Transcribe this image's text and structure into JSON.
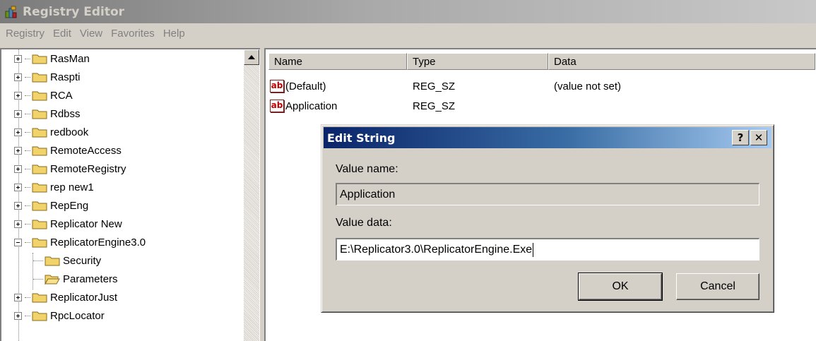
{
  "window": {
    "title": "Registry Editor",
    "icon": "registry-editor-icon"
  },
  "menu": [
    "Registry",
    "Edit",
    "View",
    "Favorites",
    "Help"
  ],
  "tree": {
    "items": [
      {
        "label": "RasMan",
        "expander": "plus",
        "icon": "folder-icon"
      },
      {
        "label": "Raspti",
        "expander": "plus",
        "icon": "folder-icon"
      },
      {
        "label": "RCA",
        "expander": "plus",
        "icon": "folder-icon"
      },
      {
        "label": "Rdbss",
        "expander": "plus",
        "icon": "folder-icon"
      },
      {
        "label": "redbook",
        "expander": "plus",
        "icon": "folder-icon"
      },
      {
        "label": "RemoteAccess",
        "expander": "plus",
        "icon": "folder-icon"
      },
      {
        "label": "RemoteRegistry",
        "expander": "plus",
        "icon": "folder-icon"
      },
      {
        "label": "rep new1",
        "expander": "plus",
        "icon": "folder-icon"
      },
      {
        "label": "RepEng",
        "expander": "plus",
        "icon": "folder-icon"
      },
      {
        "label": "Replicator New",
        "expander": "plus",
        "icon": "folder-icon"
      },
      {
        "label": "ReplicatorEngine3.0",
        "expander": "minus",
        "icon": "folder-icon"
      },
      {
        "label": "Security",
        "expander": "none",
        "icon": "folder-icon"
      },
      {
        "label": "Parameters",
        "expander": "none",
        "icon": "open-folder-icon"
      },
      {
        "label": "ReplicatorJust",
        "expander": "plus",
        "icon": "folder-icon"
      },
      {
        "label": "RpcLocator",
        "expander": "plus",
        "icon": "folder-icon"
      }
    ]
  },
  "list": {
    "columns": [
      "Name",
      "Type",
      "Data"
    ],
    "rows": [
      {
        "name": "(Default)",
        "type": "REG_SZ",
        "data": "(value not set)",
        "icon": "string-value-icon",
        "icon_text": "ab"
      },
      {
        "name": "Application",
        "type": "REG_SZ",
        "data": "",
        "icon": "string-value-icon",
        "icon_text": "ab"
      }
    ]
  },
  "dialog": {
    "title": "Edit String",
    "help_label": "?",
    "close_label": "✕",
    "value_name_label": "Value name:",
    "value_name": "Application",
    "value_data_label": "Value data:",
    "value_data": "E:\\Replicator3.0\\ReplicatorEngine.Exe",
    "ok_label": "OK",
    "cancel_label": "Cancel"
  },
  "colors": {
    "dialog_title_start": "#0a246a",
    "dialog_title_end": "#a6caf0",
    "folder": "#f2d36b",
    "string_icon": "#c00000"
  }
}
